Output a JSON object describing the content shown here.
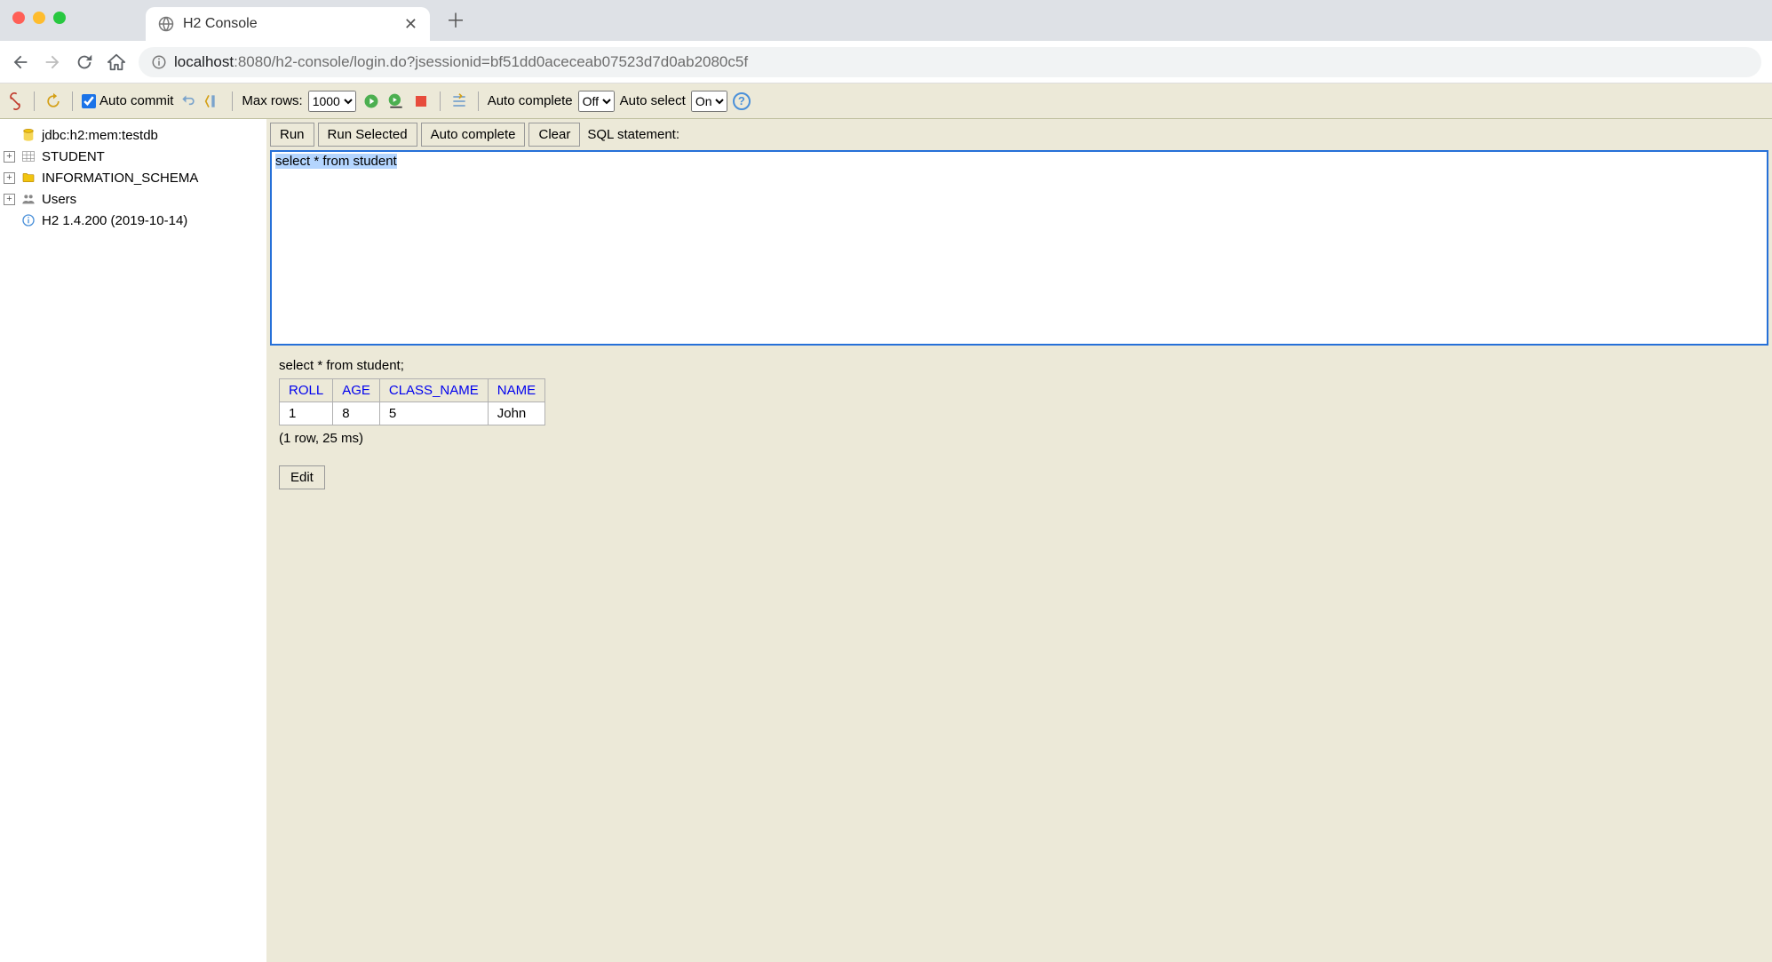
{
  "browser": {
    "tab_title": "H2 Console",
    "url_prefix": "localhost",
    "url_rest": ":8080/h2-console/login.do?jsessionid=bf51dd0aceceab07523d7d0ab2080c5f"
  },
  "toolbar": {
    "auto_commit_label": "Auto commit",
    "max_rows_label": "Max rows:",
    "max_rows_value": "1000",
    "auto_complete_label": "Auto complete",
    "auto_complete_value": "Off",
    "auto_select_label": "Auto select",
    "auto_select_value": "On"
  },
  "sidebar": {
    "connection": "jdbc:h2:mem:testdb",
    "items": [
      {
        "label": "STUDENT",
        "icon": "table"
      },
      {
        "label": "INFORMATION_SCHEMA",
        "icon": "folder"
      },
      {
        "label": "Users",
        "icon": "users"
      }
    ],
    "version": "H2 1.4.200 (2019-10-14)"
  },
  "sql": {
    "run_label": "Run",
    "run_selected_label": "Run Selected",
    "auto_complete_btn_label": "Auto complete",
    "clear_label": "Clear",
    "statement_label": "SQL statement:",
    "editor_text": "select * from student"
  },
  "results": {
    "query_echo": "select * from student;",
    "columns": [
      "ROLL",
      "AGE",
      "CLASS_NAME",
      "NAME"
    ],
    "rows": [
      [
        "1",
        "8",
        "5",
        "John"
      ]
    ],
    "meta": "(1 row, 25 ms)",
    "edit_label": "Edit"
  }
}
